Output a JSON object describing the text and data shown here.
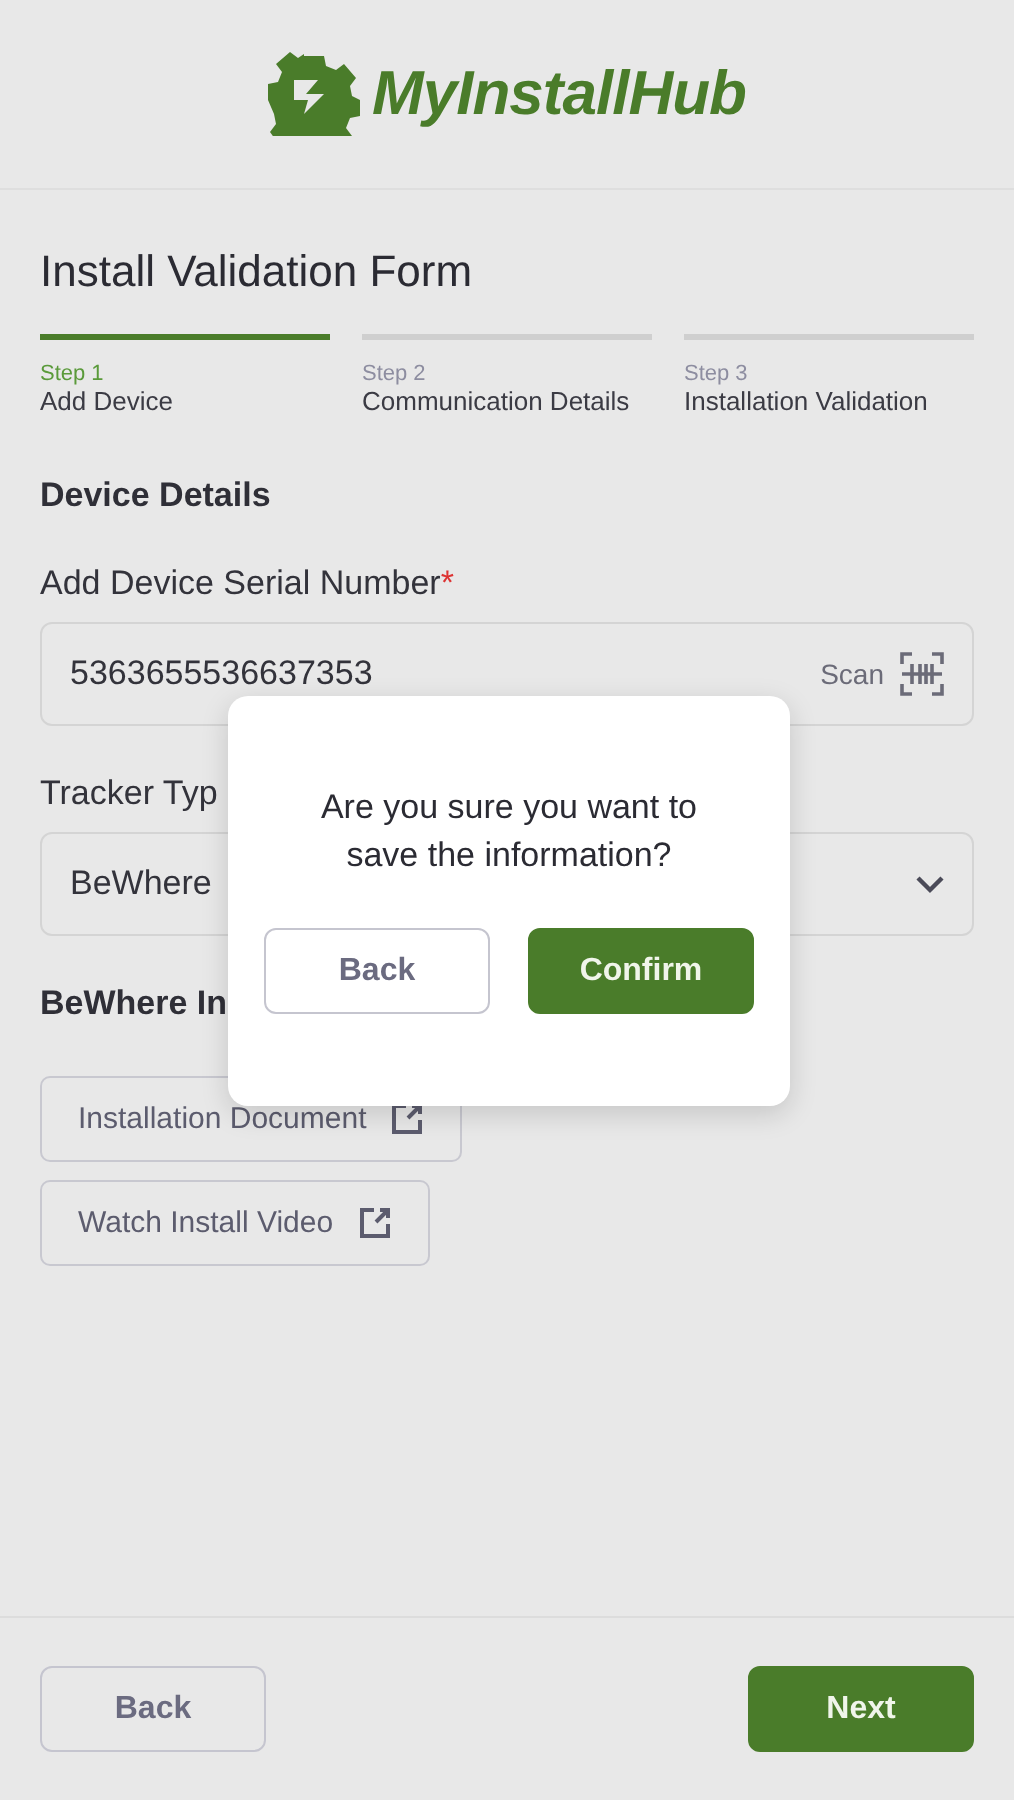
{
  "header": {
    "brand": "MyInstallHub"
  },
  "form": {
    "title": "Install Validation Form",
    "steps": [
      {
        "step": "Step 1",
        "label": "Add Device",
        "selected": true
      },
      {
        "step": "Step 2",
        "label": "Communication Details",
        "selected": false
      },
      {
        "step": "Step 3",
        "label": "Installation Validation",
        "selected": false
      }
    ],
    "section": "Device Details",
    "serial": {
      "label": "Add Device Serial Number",
      "required_mark": "*",
      "value": "5363655536637353",
      "action": "Scan"
    },
    "tracker": {
      "label": "Tracker Typ",
      "value": "BeWhere"
    },
    "resources": {
      "heading": "BeWhere In",
      "links": [
        "Installation Document",
        "Watch Install Video"
      ]
    }
  },
  "dialog": {
    "message": "Are you sure you want to save the information?",
    "buttons": [
      {
        "label": "Back",
        "kind": "secondary"
      },
      {
        "label": "Confirm",
        "kind": "primary"
      }
    ]
  },
  "footer": {
    "buttons": [
      {
        "label": "Back",
        "kind": "secondary"
      },
      {
        "label": "Next",
        "kind": "primary"
      }
    ]
  }
}
